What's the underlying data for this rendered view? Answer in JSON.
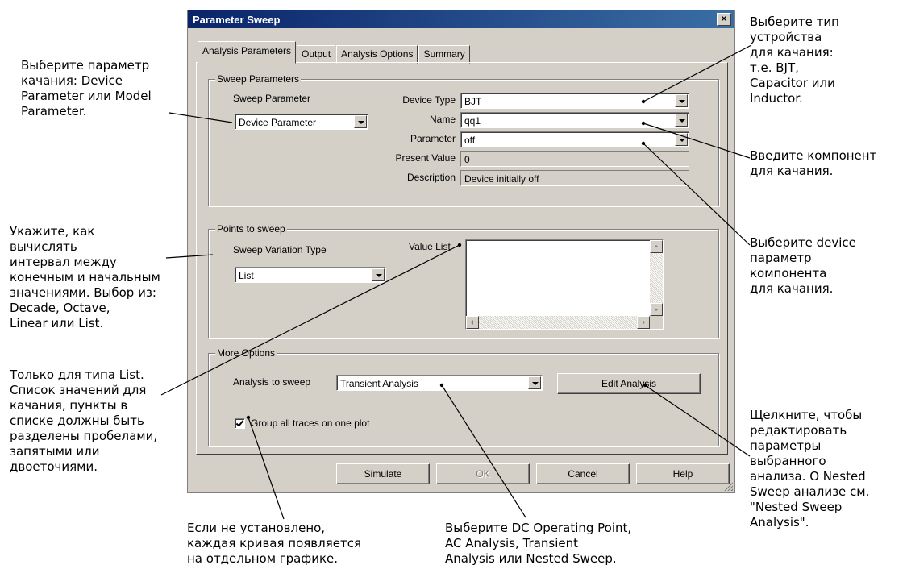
{
  "dialog": {
    "title": "Parameter Sweep",
    "close_label": "×",
    "tabs": [
      {
        "label": "Analysis Parameters",
        "active": true
      },
      {
        "label": "Output",
        "active": false
      },
      {
        "label": "Analysis Options",
        "active": false
      },
      {
        "label": "Summary",
        "active": false
      }
    ],
    "sweep_parameters": {
      "group_label": "Sweep Parameters",
      "sweep_parameter_label": "Sweep Parameter",
      "sweep_parameter_value": "Device Parameter",
      "device_type_label": "Device Type",
      "device_type_value": "BJT",
      "name_label": "Name",
      "name_value": "qq1",
      "parameter_label": "Parameter",
      "parameter_value": "off",
      "present_value_label": "Present Value",
      "present_value": "0",
      "description_label": "Description",
      "description_value": "Device initially off"
    },
    "points_to_sweep": {
      "group_label": "Points to sweep",
      "variation_label": "Sweep Variation Type",
      "variation_value": "List",
      "value_list_label": "Value List",
      "value_list": ""
    },
    "more_options": {
      "group_label": "More Options",
      "analysis_label": "Analysis to sweep",
      "analysis_value": "Transient Analysis",
      "edit_button": "Edit Analysis",
      "group_traces_label": "Group all traces on one plot",
      "group_traces_checked": true
    },
    "buttons": {
      "simulate": "Simulate",
      "ok": "OK",
      "cancel": "Cancel",
      "help": "Help"
    }
  },
  "annotations": {
    "sweep_param": [
      "Выберите параметр",
      "качания: Device",
      "Parameter или Model",
      "Parameter."
    ],
    "device_type": [
      "Выберите тип",
      "устройства",
      "для качания:",
      "т.е. BJT,",
      "Capacitor или",
      "Inductor."
    ],
    "name": [
      "Введите компонент",
      "для качания."
    ],
    "parameter": [
      "Выберите device",
      "параметр",
      "компонента",
      "для качания."
    ],
    "variation": [
      "Укажите, как",
      "вычислять",
      "интервал между",
      "конечным и начальным",
      "значениями. Выбор из:",
      "Decade, Octave,",
      "Linear или List."
    ],
    "value_list": [
      "Только для типа List.",
      "Список значений для",
      "качания, пункты в",
      "списке должны быть",
      "разделены пробелами,",
      "запятыми или",
      "двоеточиями."
    ],
    "edit": [
      "Щелкните, чтобы",
      "редактировать",
      "параметры",
      "выбранного",
      "анализа. О Nested",
      "Sweep анализе см.",
      "\"Nested Sweep",
      "Analysis\"."
    ],
    "checkbox": [
      "Если не установлено,",
      "каждая кривая появляется",
      "на отдельном графике."
    ],
    "analysis": [
      "Выберите DC Operating Point,",
      "AC Analysis, Transient",
      "Analysis или Nested Sweep."
    ]
  }
}
